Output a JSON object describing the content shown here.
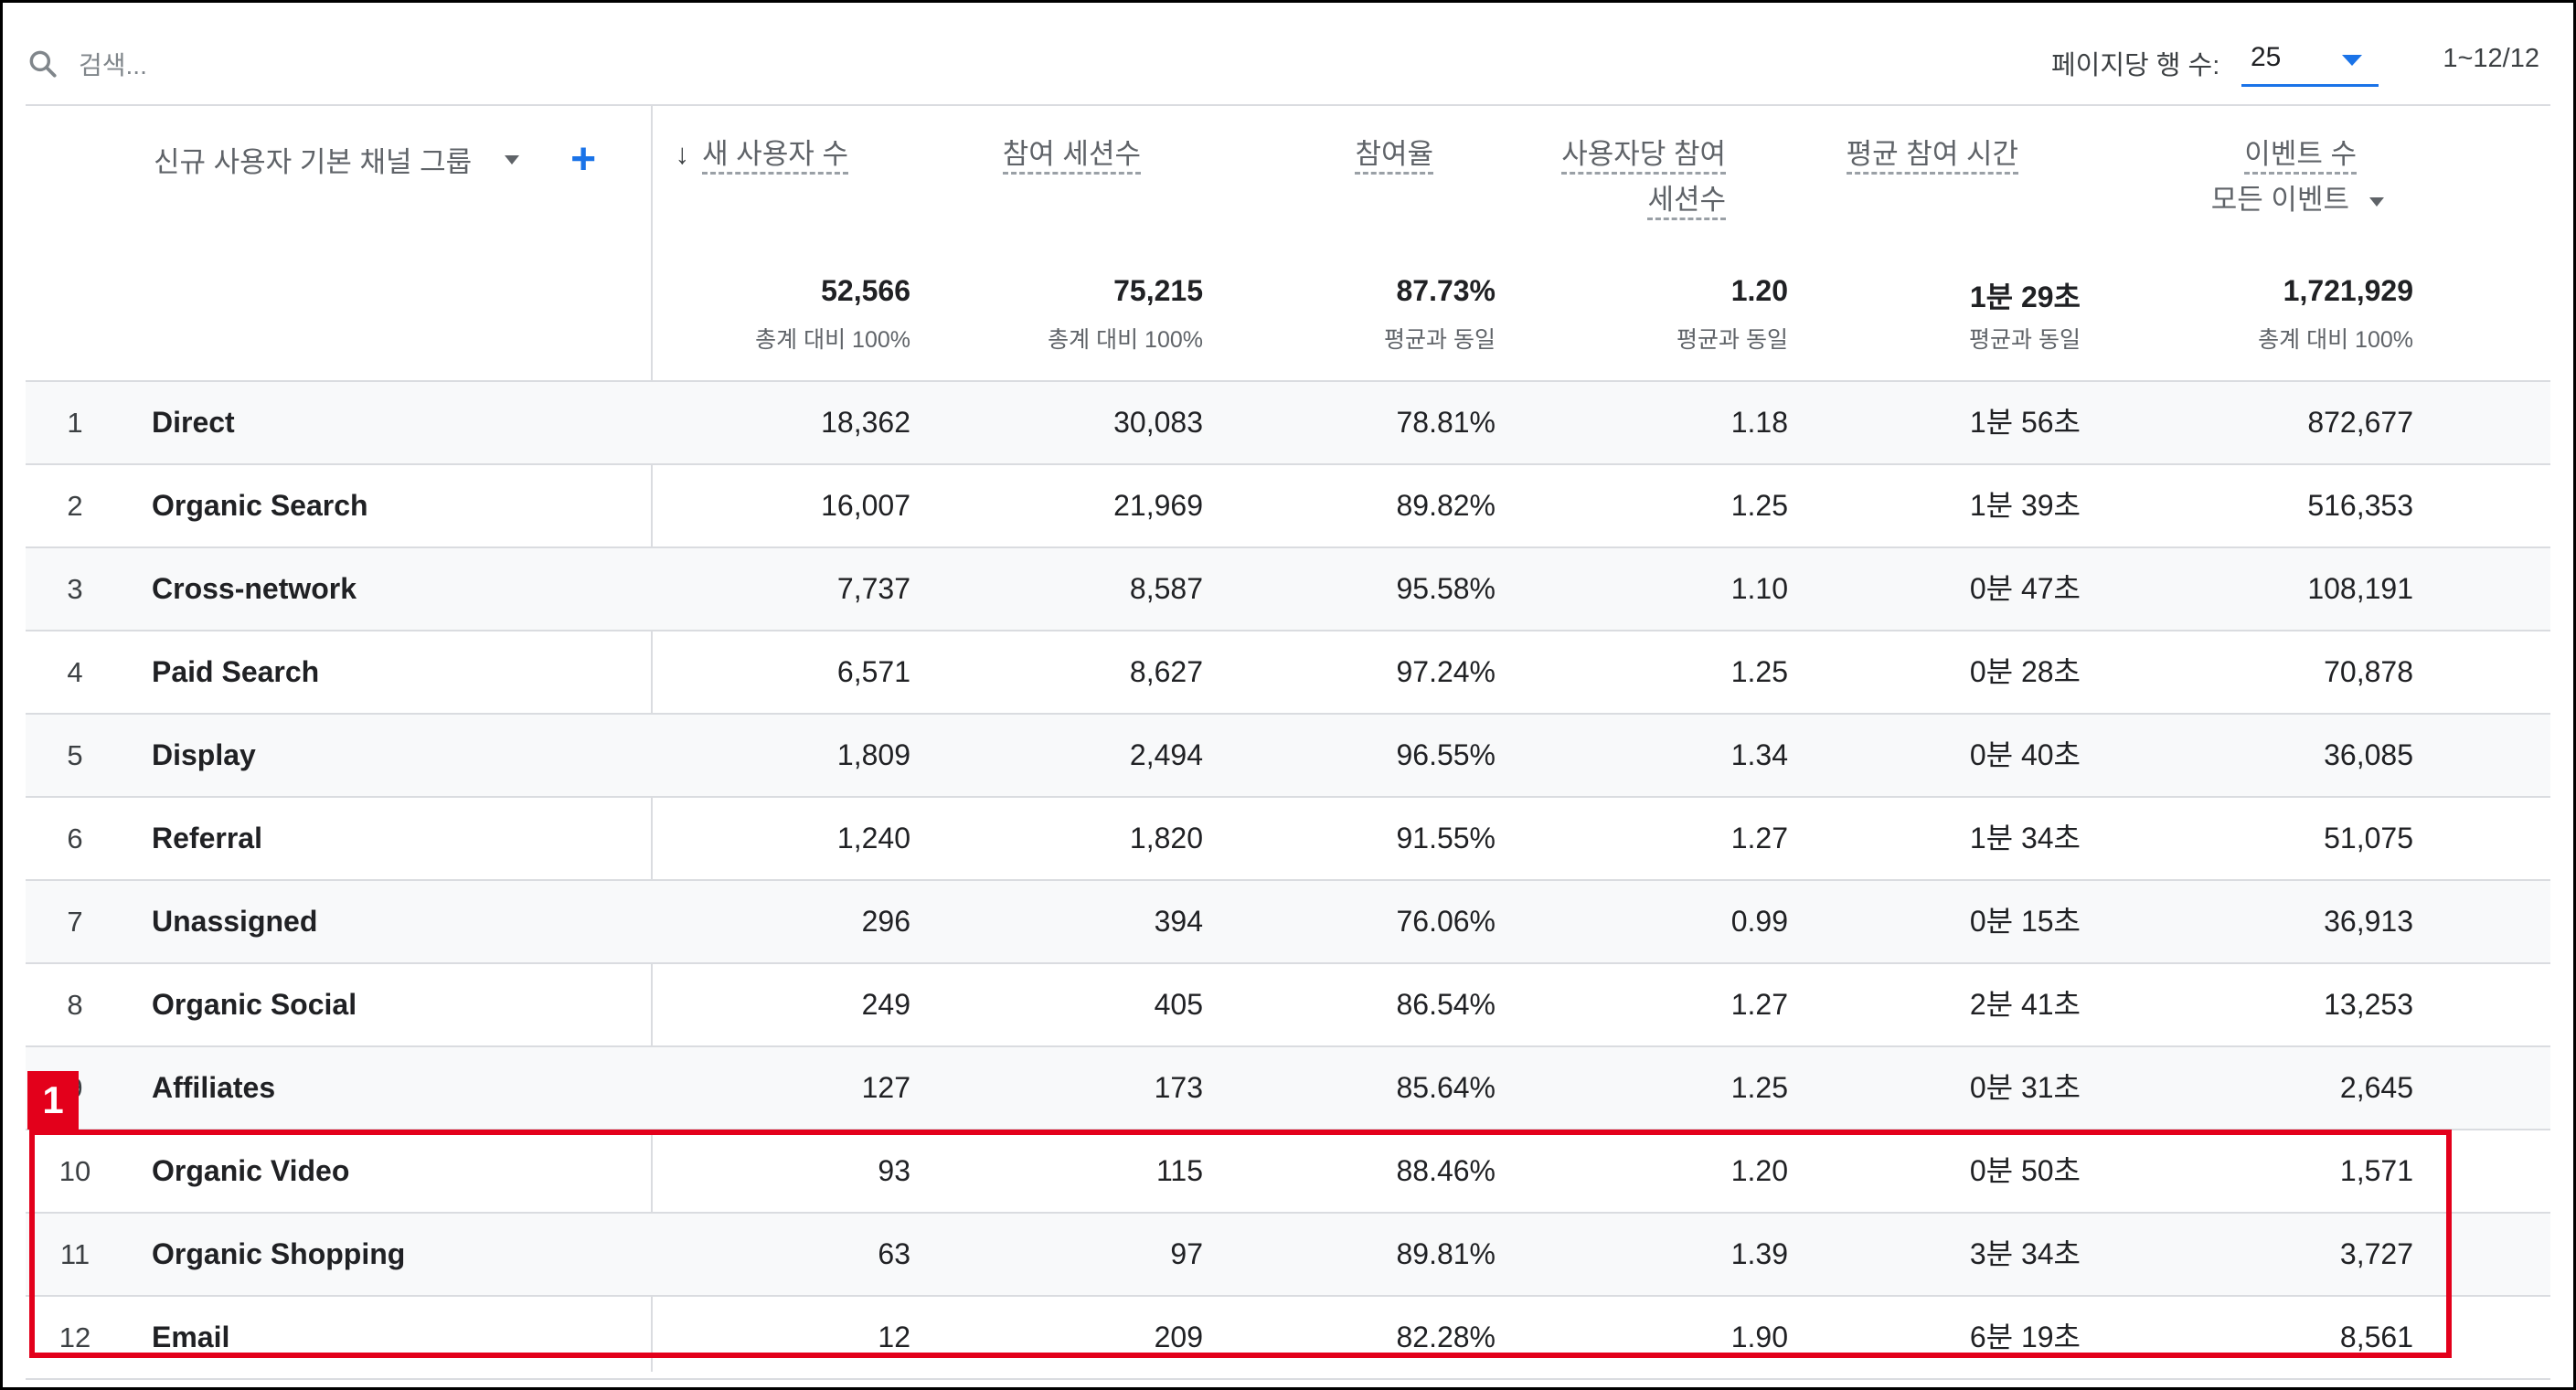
{
  "toolbar": {
    "search_placeholder": "검색...",
    "rows_per_page_label": "페이지당 행 수:",
    "rows_per_page_value": "25",
    "range_text": "1~12/12"
  },
  "table": {
    "dimension_header": "신규 사용자 기본 채널 그룹",
    "add_icon": "plus-icon",
    "columns": [
      {
        "line1": "새 사용자 수",
        "line2": "",
        "sorted": true,
        "total": "52,566",
        "total_sub": "총계 대비 100%"
      },
      {
        "line1": "참여 세션수",
        "line2": "",
        "total": "75,215",
        "total_sub": "총계 대비 100%"
      },
      {
        "line1": "참여율",
        "line2": "",
        "total": "87.73%",
        "total_sub": "평균과 동일"
      },
      {
        "line1": "사용자당 참여",
        "line2": "세션수",
        "total": "1.20",
        "total_sub": "평균과 동일"
      },
      {
        "line1": "평균 참여 시간",
        "line2": "",
        "total": "1분 29초",
        "total_sub": "평균과 동일"
      },
      {
        "line1": "이벤트 수",
        "line2": "모든 이벤트",
        "dropdown": true,
        "total": "1,721,929",
        "total_sub": "총계 대비 100%"
      }
    ],
    "rows": [
      {
        "idx": "1",
        "name": "Direct",
        "values": [
          "18,362",
          "30,083",
          "78.81%",
          "1.18",
          "1분 56초",
          "872,677"
        ]
      },
      {
        "idx": "2",
        "name": "Organic Search",
        "values": [
          "16,007",
          "21,969",
          "89.82%",
          "1.25",
          "1분 39초",
          "516,353"
        ]
      },
      {
        "idx": "3",
        "name": "Cross-network",
        "values": [
          "7,737",
          "8,587",
          "95.58%",
          "1.10",
          "0분 47초",
          "108,191"
        ]
      },
      {
        "idx": "4",
        "name": "Paid Search",
        "values": [
          "6,571",
          "8,627",
          "97.24%",
          "1.25",
          "0분 28초",
          "70,878"
        ]
      },
      {
        "idx": "5",
        "name": "Display",
        "values": [
          "1,809",
          "2,494",
          "96.55%",
          "1.34",
          "0분 40초",
          "36,085"
        ]
      },
      {
        "idx": "6",
        "name": "Referral",
        "values": [
          "1,240",
          "1,820",
          "91.55%",
          "1.27",
          "1분 34초",
          "51,075"
        ]
      },
      {
        "idx": "7",
        "name": "Unassigned",
        "values": [
          "296",
          "394",
          "76.06%",
          "0.99",
          "0분 15초",
          "36,913"
        ]
      },
      {
        "idx": "8",
        "name": "Organic Social",
        "values": [
          "249",
          "405",
          "86.54%",
          "1.27",
          "2분 41초",
          "13,253"
        ]
      },
      {
        "idx": "9",
        "name": "Affiliates",
        "values": [
          "127",
          "173",
          "85.64%",
          "1.25",
          "0분 31초",
          "2,645"
        ]
      },
      {
        "idx": "10",
        "name": "Organic Video",
        "values": [
          "93",
          "115",
          "88.46%",
          "1.20",
          "0분 50초",
          "1,571"
        ]
      },
      {
        "idx": "11",
        "name": "Organic Shopping",
        "values": [
          "63",
          "97",
          "89.81%",
          "1.39",
          "3분 34초",
          "3,727"
        ]
      },
      {
        "idx": "12",
        "name": "Email",
        "values": [
          "12",
          "209",
          "82.28%",
          "1.90",
          "6분 19초",
          "8,561"
        ]
      }
    ]
  },
  "annotation": {
    "label": "1",
    "color": "#e3001b"
  }
}
